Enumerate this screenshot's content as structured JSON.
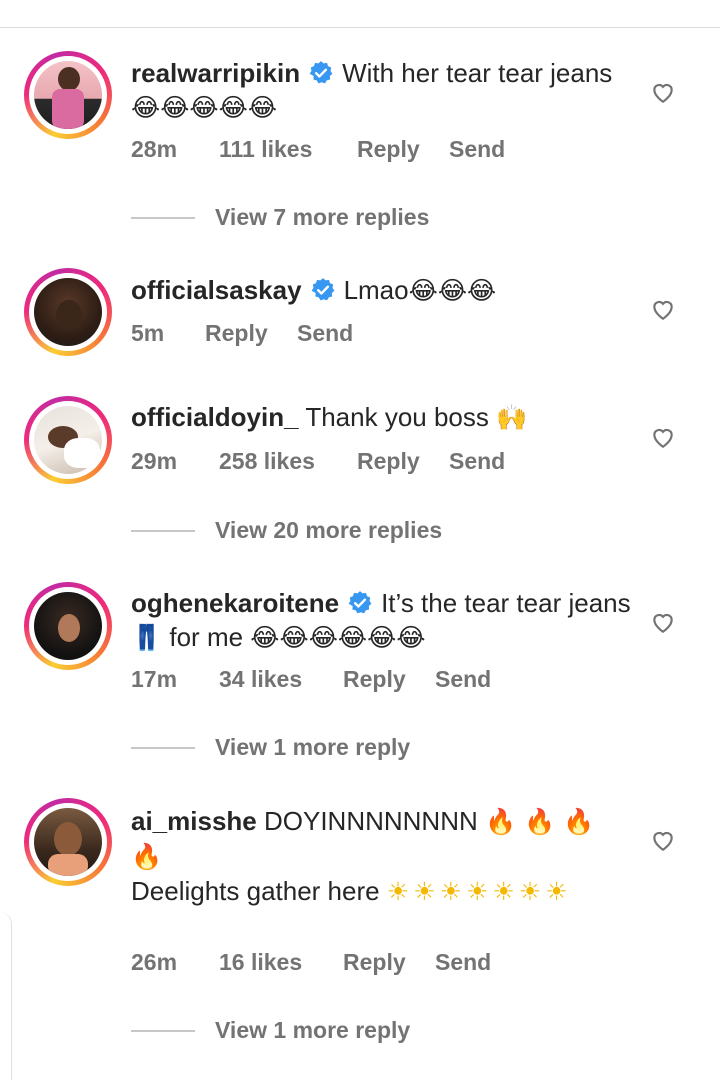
{
  "comments": [
    {
      "username": "realwarripikin",
      "verified": true,
      "text": "With her tear tear jeans",
      "emojis": "😂😂😂😂😂",
      "time": "28m",
      "likes": "111 likes",
      "reply": "Reply",
      "send": "Send",
      "view_replies": "View 7 more replies"
    },
    {
      "username": "officialsaskay",
      "verified": true,
      "text": "Lmao",
      "emojis": "😂😂😂",
      "time": "5m",
      "reply": "Reply",
      "send": "Send"
    },
    {
      "username": "officialdoyin_",
      "verified": false,
      "text": "Thank you boss",
      "emojis": "🙌",
      "time": "29m",
      "likes": "258 likes",
      "reply": "Reply",
      "send": "Send",
      "view_replies": "View 20 more replies"
    },
    {
      "username": "oghenekaroitene",
      "verified": true,
      "text": "It’s the tear tear jeans",
      "emoji_mid": "👖",
      "text2": "for me",
      "emojis": "😂😂😂😂😂😂",
      "time": "17m",
      "likes": "34 likes",
      "reply": "Reply",
      "send": "Send",
      "view_replies": "View 1 more reply"
    },
    {
      "username": "ai_misshe",
      "verified": false,
      "text": "DOYINNNNNNNN",
      "emojis": "🔥 🔥 🔥 🔥",
      "text2": "Deelights gather here",
      "emojis2": "☀☀☀☀☀☀☀",
      "time": "26m",
      "likes": "16 likes",
      "reply": "Reply",
      "send": "Send",
      "view_replies": "View 1 more reply"
    }
  ],
  "colors": {
    "text": "#262626",
    "meta": "#737373",
    "verified": "#3897f0",
    "laugh": "#f5b800"
  },
  "icons": [
    "verified-badge-icon",
    "heart-icon"
  ]
}
